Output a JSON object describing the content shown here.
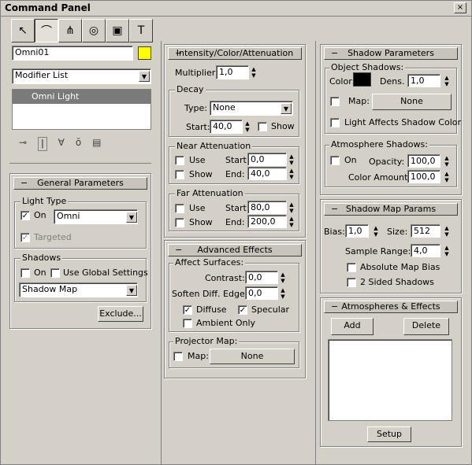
{
  "window": {
    "title": "Command Panel",
    "close": "×"
  },
  "tabs": [
    {
      "icon": "create-icon",
      "glyph": "↖"
    },
    {
      "icon": "modify-icon",
      "glyph": "⌒"
    },
    {
      "icon": "hierarchy-icon",
      "glyph": "⋔"
    },
    {
      "icon": "motion-icon",
      "glyph": "◎"
    },
    {
      "icon": "display-icon",
      "glyph": "▣"
    },
    {
      "icon": "utilities-icon",
      "glyph": "T"
    }
  ],
  "object": {
    "name": "Omni01",
    "color": "#ffff00"
  },
  "modifier_list": "Modifier List",
  "stack": {
    "selected": "Omni Light"
  },
  "stack_tools": [
    "pin-icon",
    "show-end-icon",
    "make-unique-icon",
    "remove-modifier-icon",
    "configure-icon"
  ],
  "general": {
    "title": "General Parameters",
    "minus": "−",
    "light_type_label": "Light Type",
    "on_label": "On",
    "on_checked": "✓",
    "type_value": "Omni",
    "targeted_label": "Targeted",
    "targeted_checked": "✓",
    "shadows_label": "Shadows",
    "shadows_on": "On",
    "use_global": "Use Global Settings",
    "shadow_type": "Shadow Map",
    "exclude": "Exclude..."
  },
  "intensity": {
    "title": "Intensity/Color/Attenuation",
    "minus": "−",
    "multiplier_label": "Multiplier:",
    "multiplier": "1,0",
    "decay_label": "Decay",
    "type_label": "Type:",
    "type_value": "None",
    "start_label": "Start:",
    "start_value": "40,0",
    "show_label": "Show",
    "near_label": "Near Attenuation",
    "near_use": "Use",
    "near_show": "Show",
    "near_start_label": "Start:",
    "near_start": "0,0",
    "near_end_label": "End:",
    "near_end": "40,0",
    "far_label": "Far Attenuation",
    "far_use": "Use",
    "far_show": "Show",
    "far_start_label": "Start:",
    "far_start": "80,0",
    "far_end_label": "End:",
    "far_end": "200,0"
  },
  "advanced": {
    "title": "Advanced Effects",
    "minus": "−",
    "affect_label": "Affect Surfaces:",
    "contrast_label": "Contrast:",
    "contrast": "0,0",
    "soften_label": "Soften Diff. Edge:",
    "soften": "0,0",
    "diffuse_label": "Diffuse",
    "diffuse_checked": "✓",
    "specular_label": "Specular",
    "specular_checked": "✓",
    "ambient_label": "Ambient Only",
    "projector_label": "Projector Map:",
    "map_label": "Map:",
    "map_value": "None"
  },
  "shadow_params": {
    "title": "Shadow Parameters",
    "minus": "−",
    "object_shadows": "Object Shadows:",
    "color_label": "Color:",
    "color_value": "#000000",
    "dens_label": "Dens.",
    "dens": "1,0",
    "map_label": "Map:",
    "map_value": "None",
    "light_affects": "Light Affects Shadow Color",
    "atmos_label": "Atmosphere Shadows:",
    "atmos_on": "On",
    "opacity_label": "Opacity:",
    "opacity": "100,0",
    "color_amount_label": "Color Amount:",
    "color_amount": "100,0"
  },
  "shadow_map": {
    "title": "Shadow Map Params",
    "minus": "−",
    "bias_label": "Bias:",
    "bias": "1,0",
    "size_label": "Size:",
    "size": "512",
    "sample_label": "Sample Range:",
    "sample": "4,0",
    "absolute_label": "Absolute Map Bias",
    "two_sided_label": "2 Sided Shadows"
  },
  "atmos_effects": {
    "title": "Atmospheres & Effects",
    "minus": "−",
    "add": "Add",
    "delete": "Delete",
    "setup": "Setup"
  }
}
